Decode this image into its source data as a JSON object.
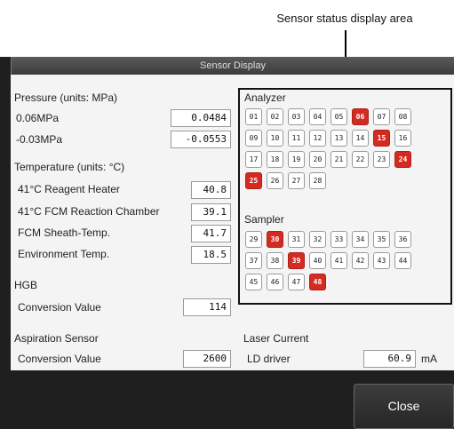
{
  "callout": "Sensor status display area",
  "dialog": {
    "title": "Sensor Display",
    "close_label": "Close"
  },
  "pressure": {
    "heading": "Pressure (units: MPa)",
    "rows": [
      {
        "label": "0.06MPa",
        "value": "0.0484"
      },
      {
        "label": "-0.03MPa",
        "value": "-0.0553"
      }
    ]
  },
  "temperature": {
    "heading": "Temperature (units: °C)",
    "rows": [
      {
        "label": "41°C Reagent Heater",
        "value": "40.8"
      },
      {
        "label": "41°C FCM Reaction Chamber",
        "value": "39.1"
      },
      {
        "label": "FCM Sheath-Temp.",
        "value": "41.7"
      },
      {
        "label": "Environment Temp.",
        "value": "18.5"
      }
    ]
  },
  "hgb": {
    "heading": "HGB",
    "label": "Conversion Value",
    "value": "114"
  },
  "aspiration": {
    "heading": "Aspiration Sensor",
    "label": "Conversion Value",
    "value": "2600"
  },
  "laser": {
    "heading": "Laser Current",
    "label": "LD driver",
    "value": "60.9",
    "unit": "mA"
  },
  "analyzer": {
    "heading": "Analyzer",
    "sensors": [
      "01",
      "02",
      "03",
      "04",
      "05",
      "06",
      "07",
      "08",
      "09",
      "10",
      "11",
      "12",
      "13",
      "14",
      "15",
      "16",
      "17",
      "18",
      "19",
      "20",
      "21",
      "22",
      "23",
      "24",
      "25",
      "26",
      "27",
      "28"
    ],
    "active": [
      "06",
      "15",
      "24",
      "25"
    ]
  },
  "sampler": {
    "heading": "Sampler",
    "sensors": [
      "29",
      "30",
      "31",
      "32",
      "33",
      "34",
      "35",
      "36",
      "37",
      "38",
      "39",
      "40",
      "41",
      "42",
      "43",
      "44",
      "45",
      "46",
      "47",
      "48"
    ],
    "active": [
      "30",
      "39",
      "48"
    ]
  },
  "colors": {
    "active": "#d32b21",
    "panel": "#f4f4f4",
    "frame": "#1f1f1f"
  }
}
